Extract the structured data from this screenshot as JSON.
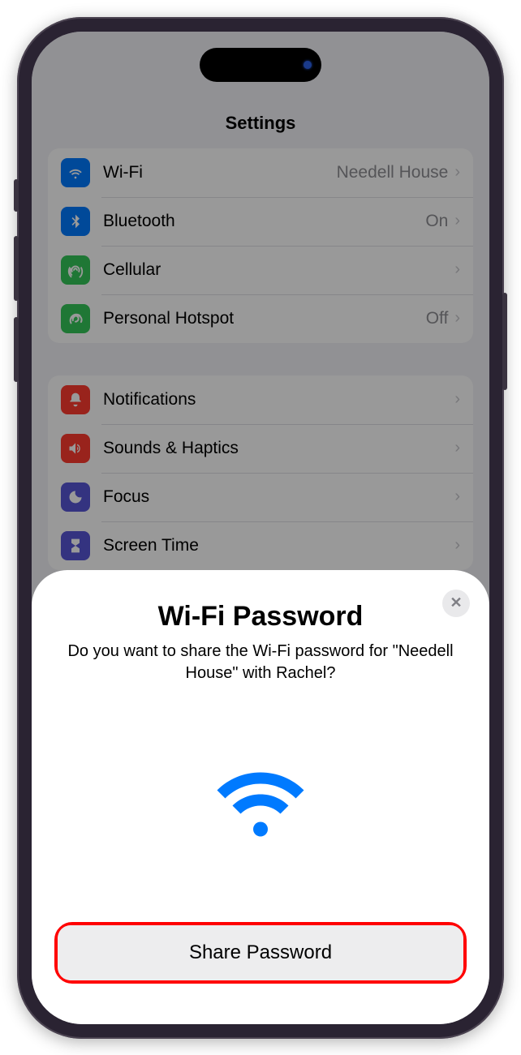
{
  "header": {
    "title": "Settings"
  },
  "group1": [
    {
      "icon": "wifi",
      "color": "icon-blue",
      "label": "Wi-Fi",
      "value": "Needell House"
    },
    {
      "icon": "bluetooth",
      "color": "icon-blue",
      "label": "Bluetooth",
      "value": "On"
    },
    {
      "icon": "cellular",
      "color": "icon-green",
      "label": "Cellular",
      "value": ""
    },
    {
      "icon": "hotspot",
      "color": "icon-green",
      "label": "Personal Hotspot",
      "value": "Off"
    }
  ],
  "group2": [
    {
      "icon": "bell",
      "color": "icon-red",
      "label": "Notifications",
      "value": ""
    },
    {
      "icon": "speaker",
      "color": "icon-red",
      "label": "Sounds & Haptics",
      "value": ""
    },
    {
      "icon": "moon",
      "color": "icon-purple",
      "label": "Focus",
      "value": ""
    },
    {
      "icon": "hourglass",
      "color": "icon-purple",
      "label": "Screen Time",
      "value": ""
    }
  ],
  "sheet": {
    "title": "Wi-Fi Password",
    "subtitle": "Do you want to share the Wi-Fi password for \"Needell House\" with Rachel?",
    "button": "Share Password"
  }
}
